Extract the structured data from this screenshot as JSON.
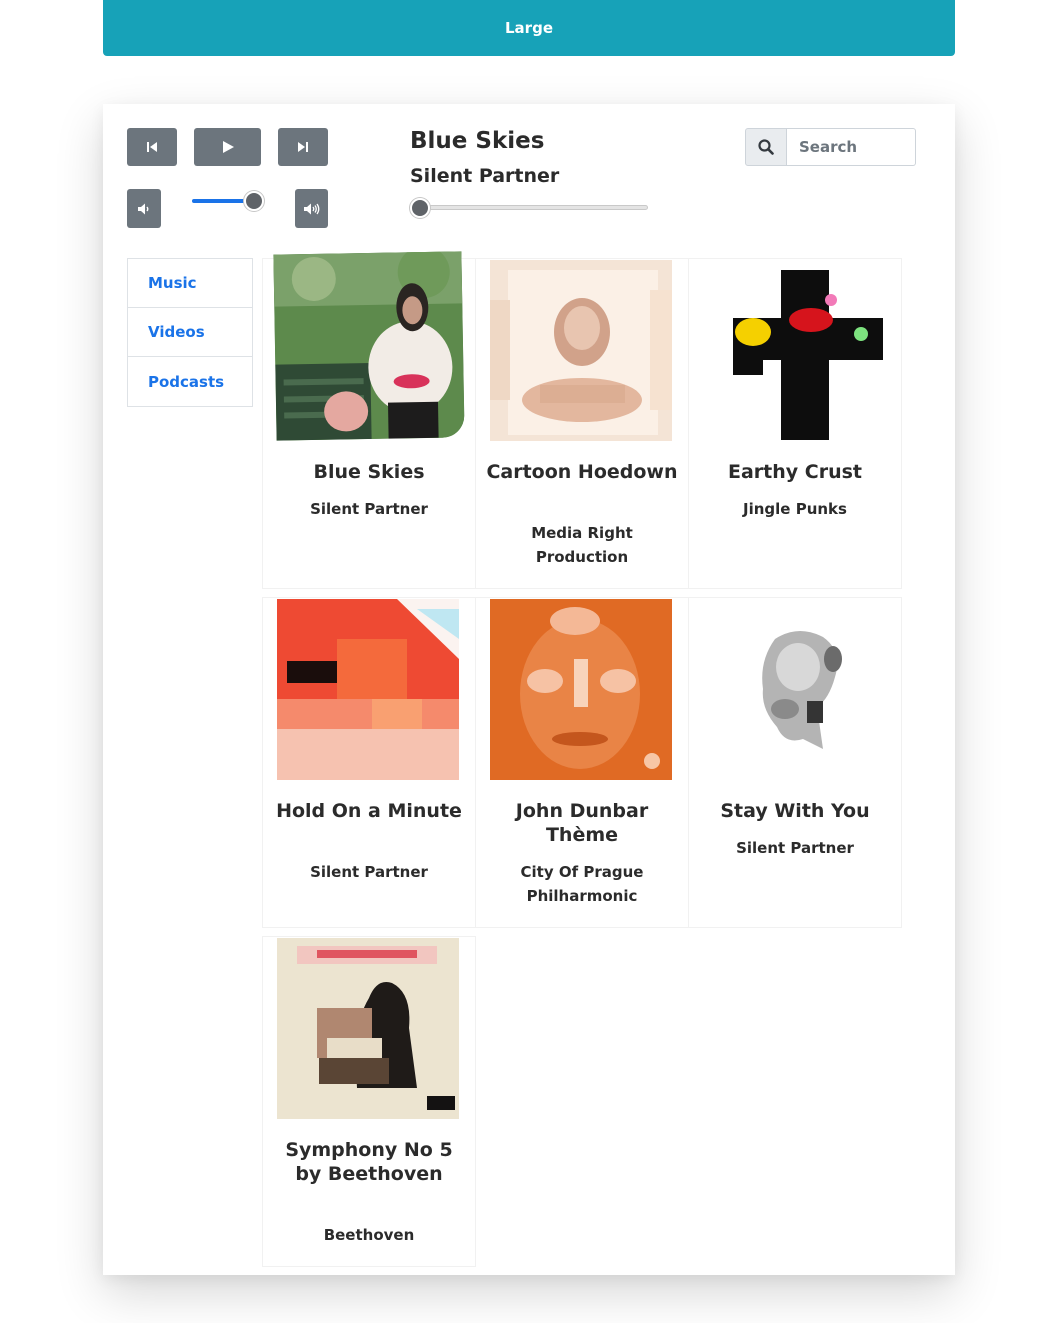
{
  "size_button": {
    "label": "Large"
  },
  "controls": {
    "prev_icon": "skip-back-icon",
    "play_icon": "play-icon",
    "next_icon": "skip-forward-icon",
    "volume_down_icon": "volume-down-icon",
    "volume_up_icon": "volume-up-icon",
    "volume_level": 0.85,
    "seek_position": 0.0
  },
  "now_playing": {
    "title": "Blue Skies",
    "artist": "Silent Partner"
  },
  "search": {
    "placeholder": "Search",
    "value": "",
    "icon": "search-icon"
  },
  "nav": {
    "items": [
      {
        "label": "Music"
      },
      {
        "label": "Videos"
      },
      {
        "label": "Podcasts"
      }
    ]
  },
  "tracks": [
    {
      "title": "Blue Skies",
      "artist": "Silent Partner"
    },
    {
      "title": "Cartoon Hoedown",
      "artist": "Media Right Production"
    },
    {
      "title": "Earthy Crust",
      "artist": "Jingle Punks"
    },
    {
      "title": "Hold On a Minute",
      "artist": "Silent Partner"
    },
    {
      "title": "John Dunbar Thème",
      "artist": "City Of Prague Philharmonic"
    },
    {
      "title": "Stay With You",
      "artist": "Silent Partner"
    },
    {
      "title": "Symphony No 5 by Beethoven",
      "artist": "Beethoven"
    }
  ],
  "colors": {
    "accent": "#17a2b8",
    "link": "#1a73e8",
    "control": "#6c757d"
  }
}
